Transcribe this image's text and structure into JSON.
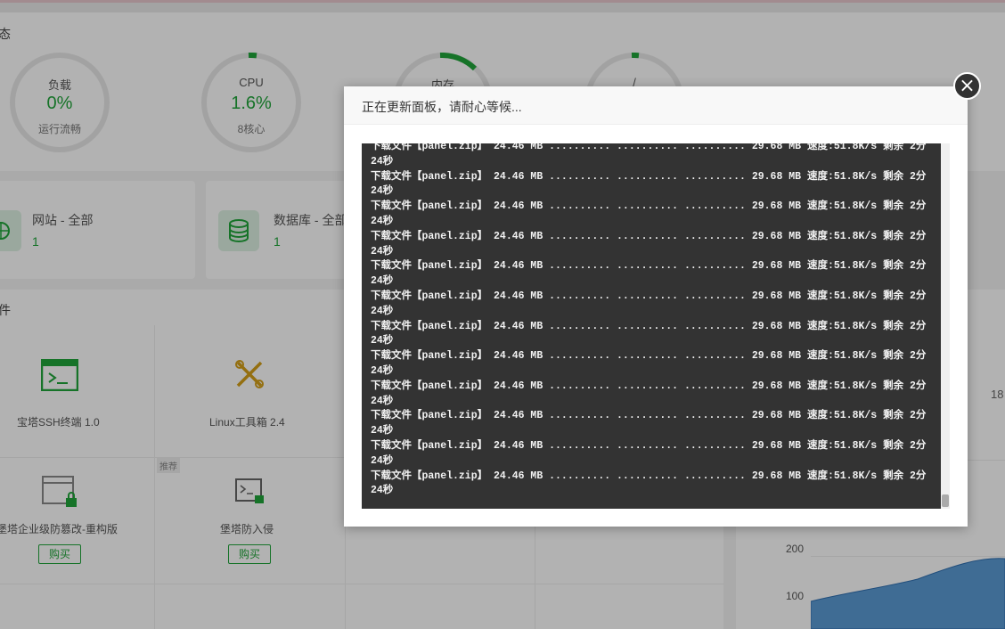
{
  "status": {
    "title": "态",
    "gauges": [
      {
        "label": "负载",
        "value": "0%",
        "sub": "运行流畅",
        "percent": 0
      },
      {
        "label": "CPU",
        "value": "1.6%",
        "sub": "8核心",
        "percent": 1.6
      },
      {
        "label": "内存",
        "value": "",
        "sub": "",
        "percent": 14
      },
      {
        "label": "/",
        "value": "",
        "sub": "",
        "percent": 2
      }
    ]
  },
  "overview": {
    "website": {
      "label": "网站 - 全部",
      "count": "1"
    },
    "database": {
      "label": "数据库 - 全部",
      "count": "1"
    }
  },
  "software": {
    "title": "件",
    "apps": [
      {
        "name": "宝塔SSH终端 1.0"
      },
      {
        "name": "Linux工具箱 2.4"
      },
      {
        "name": "堡塔企业级防篡改-重构版",
        "buy": "购买",
        "badge": "推荐"
      },
      {
        "name": "堡塔防入侵",
        "buy": "购买"
      }
    ]
  },
  "chart": {
    "edge_value": "18",
    "y_ticks": [
      "200",
      "100"
    ]
  },
  "modal": {
    "title": "正在更新面板，请耐心等候...",
    "line_text": "下载文件【panel.zip】 24.46 MB .......... .......... .......... 29.68 MB 速度:51.8K/s 剩余 2分24秒",
    "line_count": 12
  },
  "colors": {
    "accent": "#20a53a",
    "terminal_bg": "#333333"
  }
}
